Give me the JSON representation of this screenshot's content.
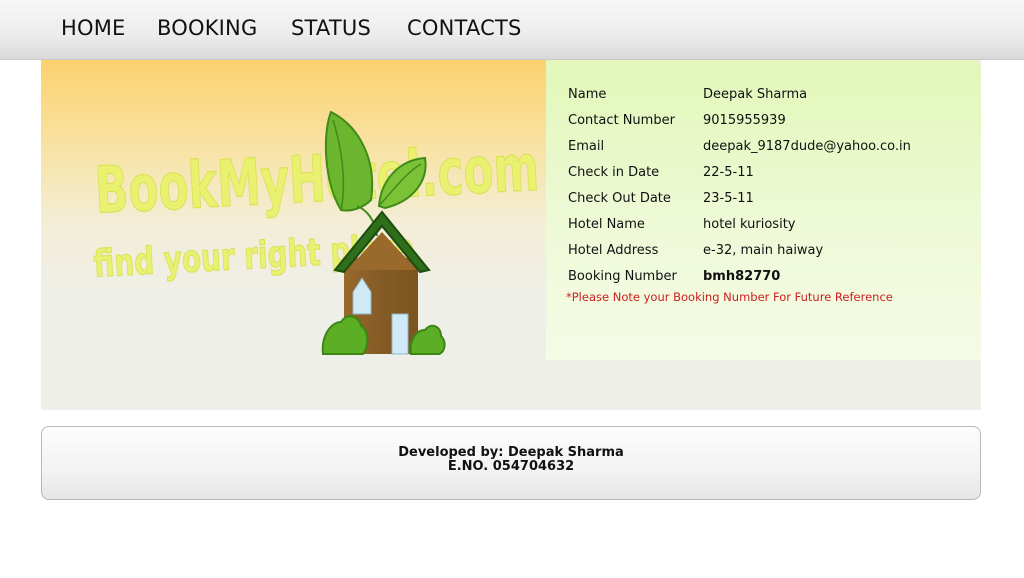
{
  "nav": {
    "items": [
      "HOME",
      "BOOKING",
      "STATUS",
      "CONTACTS"
    ]
  },
  "logo": {
    "text": "BookMyHotel.com",
    "tagline": "find your right place"
  },
  "booking": {
    "rows": [
      {
        "label": "Name",
        "value": "Deepak Sharma"
      },
      {
        "label": "Contact Number",
        "value": "9015955939"
      },
      {
        "label": "Email",
        "value": "deepak_9187dude@yahoo.co.in"
      },
      {
        "label": "Check in Date",
        "value": "22-5-11"
      },
      {
        "label": "Check Out Date",
        "value": "23-5-11"
      },
      {
        "label": "Hotel Name",
        "value": "hotel kuriosity"
      },
      {
        "label": "Hotel Address",
        "value": "e-32, main haiway"
      },
      {
        "label": "Booking Number",
        "value": "bmh82770"
      }
    ],
    "note": "*Please Note your Booking Number For Future Reference"
  },
  "footer": {
    "developed_by": "Developed by: Deepak Sharma",
    "eno": "E.NO. 054704632"
  },
  "colors": {
    "banner_top": "#fcd16e",
    "details_bg": "#e2f7b8",
    "note_red": "#cc1f1f",
    "logo_text": "#e9f26a"
  }
}
